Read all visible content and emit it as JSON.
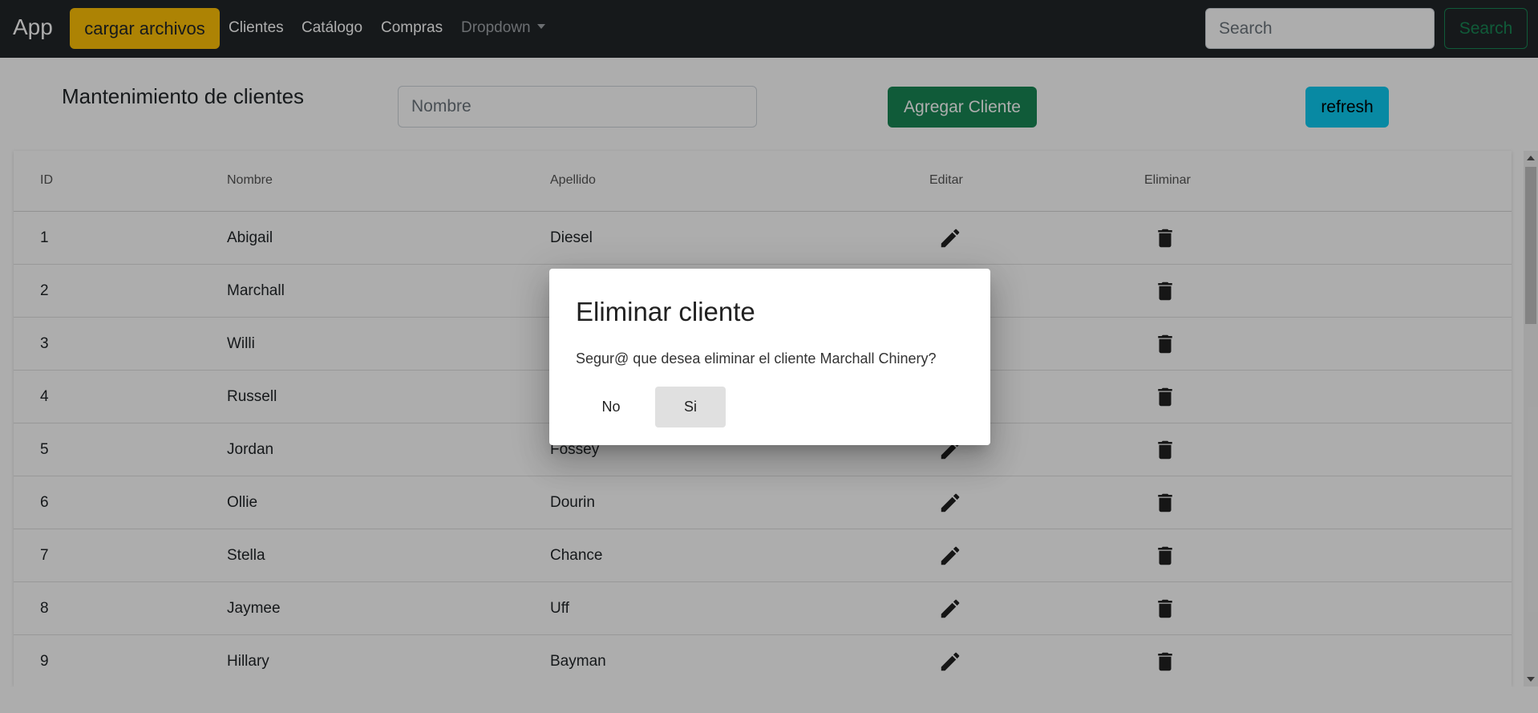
{
  "navbar": {
    "brand": "App",
    "upload_button": "cargar archivos",
    "links": [
      "Clientes",
      "Catálogo",
      "Compras"
    ],
    "dropdown": "Dropdown",
    "search_placeholder": "Search",
    "search_button": "Search"
  },
  "page": {
    "title": "Mantenimiento de clientes",
    "name_placeholder": "Nombre",
    "add_button": "Agregar Cliente",
    "refresh_button": "refresh"
  },
  "table": {
    "headers": [
      "ID",
      "Nombre",
      "Apellido",
      "Editar",
      "Eliminar"
    ],
    "rows": [
      {
        "id": "1",
        "nombre": "Abigail",
        "apellido": "Diesel"
      },
      {
        "id": "2",
        "nombre": "Marchall",
        "apellido": ""
      },
      {
        "id": "3",
        "nombre": "Willi",
        "apellido": ""
      },
      {
        "id": "4",
        "nombre": "Russell",
        "apellido": ""
      },
      {
        "id": "5",
        "nombre": "Jordan",
        "apellido": "Fossey"
      },
      {
        "id": "6",
        "nombre": "Ollie",
        "apellido": "Dourin"
      },
      {
        "id": "7",
        "nombre": "Stella",
        "apellido": "Chance"
      },
      {
        "id": "8",
        "nombre": "Jaymee",
        "apellido": "Uff"
      },
      {
        "id": "9",
        "nombre": "Hillary",
        "apellido": "Bayman"
      }
    ],
    "row_icons": {
      "edit": "pencil-icon",
      "delete": "trash-icon"
    }
  },
  "dialog": {
    "title": "Eliminar cliente",
    "message": "Segur@ que desea eliminar el cliente Marchall Chinery?",
    "no_label": "No",
    "yes_label": "Si"
  },
  "colors": {
    "navbar": "#212529",
    "warning": "#ffc107",
    "success": "#198754",
    "info": "#0dcaf0"
  }
}
